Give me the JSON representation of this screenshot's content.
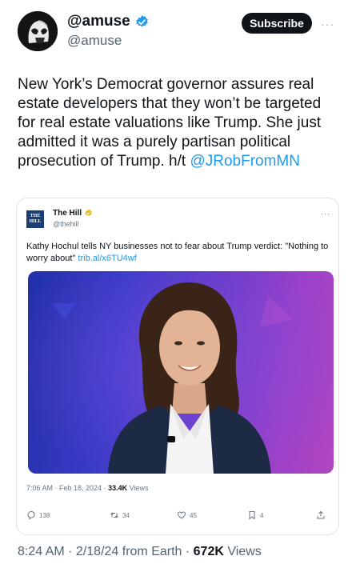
{
  "header": {
    "display_name": "@amuse",
    "handle": "@amuse",
    "subscribe_label": "Subscribe",
    "more_label": "···"
  },
  "tweet": {
    "text": "New York’s Democrat governor assures real estate developers that they won’t be targeted for real estate valuations like Trump. She just admitted it was a purely partisan political prosecution of Trump. h/t ",
    "mention": "@JRobFromMN"
  },
  "quote": {
    "logo_text_1": "THE",
    "logo_text_2": "HILL",
    "name": "The Hill",
    "handle": "@thehill",
    "more_label": "···",
    "text": "Kathy Hochul tells NY businesses not to fear about Trump verdict: \"Nothing to worry about\" ",
    "link": "trib.al/x6TU4wf",
    "meta_time": "7:06 AM · Feb 18, 2024 · ",
    "meta_views": "33.4K",
    "meta_views_label": " Views",
    "replies": "138",
    "retweets": "34",
    "likes": "45",
    "bookmarks": "4"
  },
  "footer": {
    "time": "8:24 AM · 2/18/24 from Earth · ",
    "views": "672K",
    "views_label": " Views"
  },
  "colors": {
    "accent": "#1d9bf0",
    "text": "#0f1419",
    "muted": "#536471"
  },
  "icons": {
    "verified": "verified-badge-icon",
    "reply": "reply-icon",
    "retweet": "retweet-icon",
    "like": "heart-icon",
    "bookmark": "bookmark-icon",
    "share": "share-icon"
  }
}
